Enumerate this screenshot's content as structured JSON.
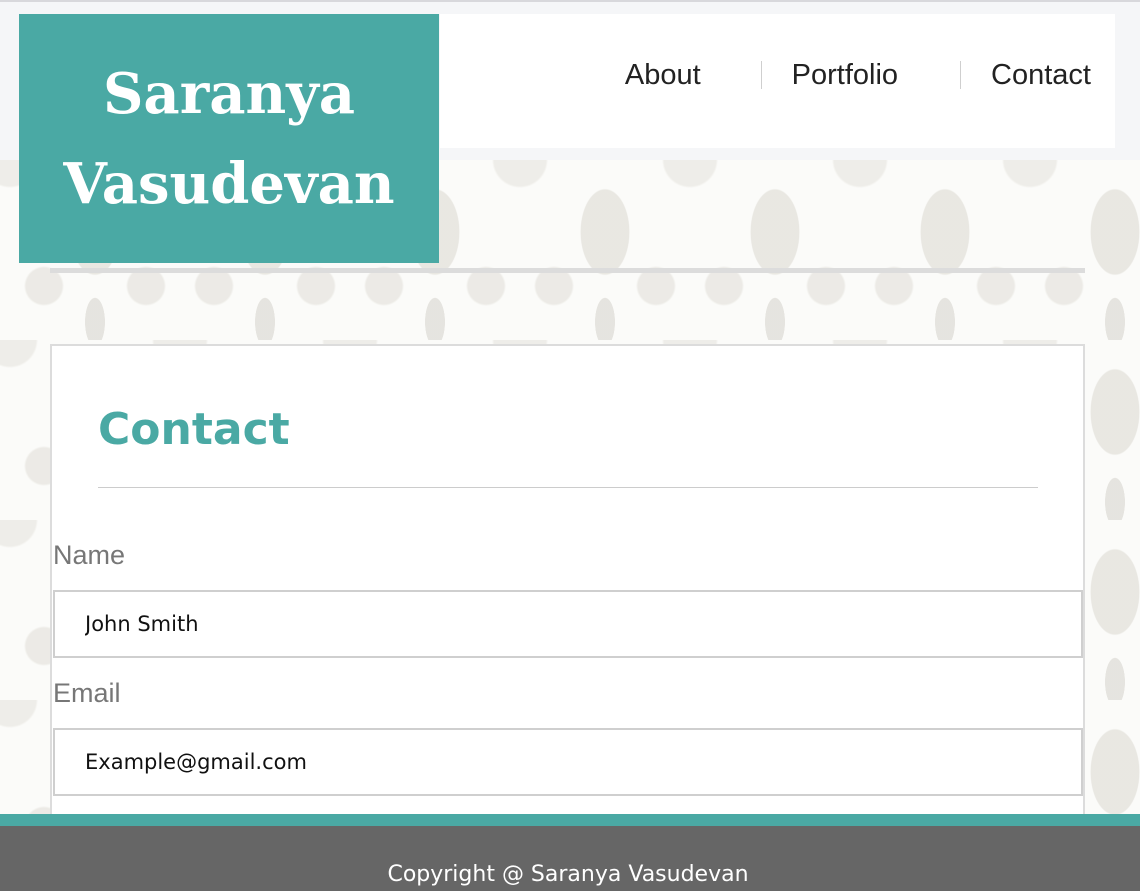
{
  "header": {
    "logo_text": "Saranya Vasudevan",
    "nav": {
      "about": "About",
      "portfolio": "Portfolio",
      "contact": "Contact"
    }
  },
  "contact_card": {
    "title": "Contact",
    "name_label": "Name",
    "name_value": "John Smith",
    "email_label": "Email",
    "email_value": "Example@gmail.com"
  },
  "footer": {
    "copyright": "Copyright @ Saranya Vasudevan"
  },
  "colors": {
    "accent": "#4aa9a4",
    "footer_bg": "#666666",
    "nav_text": "#222222"
  }
}
